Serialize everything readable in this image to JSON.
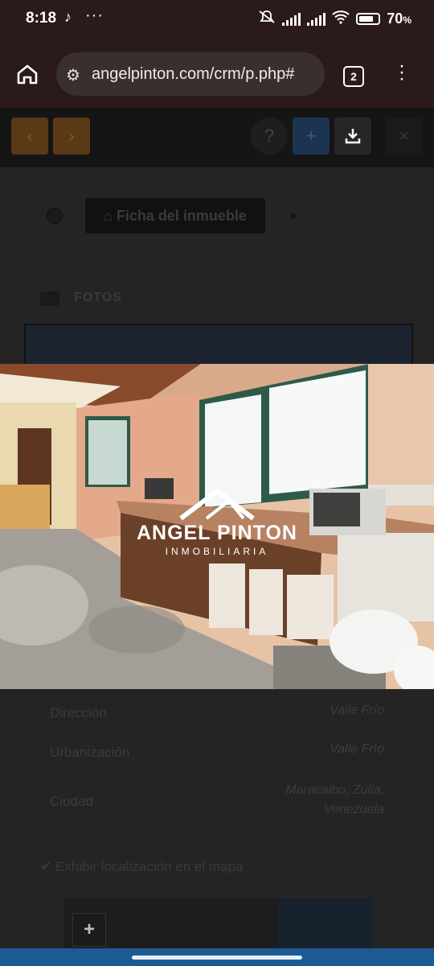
{
  "status_bar": {
    "time": "8:18",
    "dots": "···",
    "battery": "70",
    "battery_unit": "%",
    "icons": [
      "tiktok-icon",
      "mute-icon",
      "signal-icon",
      "wifi-icon",
      "battery-icon"
    ]
  },
  "browser": {
    "url": "angelpinton.com/crm/p.php#",
    "tab_count": "2"
  },
  "toolbar": {
    "back": "‹",
    "forward": "›",
    "help": "?",
    "add": "+",
    "close": "×"
  },
  "tabs": {
    "ficha_label": "Ficha del inmueble"
  },
  "section": {
    "fotos_label": "FOTOS"
  },
  "watermark": {
    "name": "ANGEL PINTON",
    "subtitle": "INMOBILIARIA"
  },
  "details": [
    {
      "label": "Dirección",
      "value": "Valle Frío"
    },
    {
      "label": "Urbanización",
      "value": "Valle Frío"
    },
    {
      "label": "Ciudad",
      "value": "Maracaibo, Zulia, Venezuela"
    }
  ],
  "map_toggle_label": "Exhibir localización en el mapa",
  "map": {
    "zoom_in": "+"
  }
}
